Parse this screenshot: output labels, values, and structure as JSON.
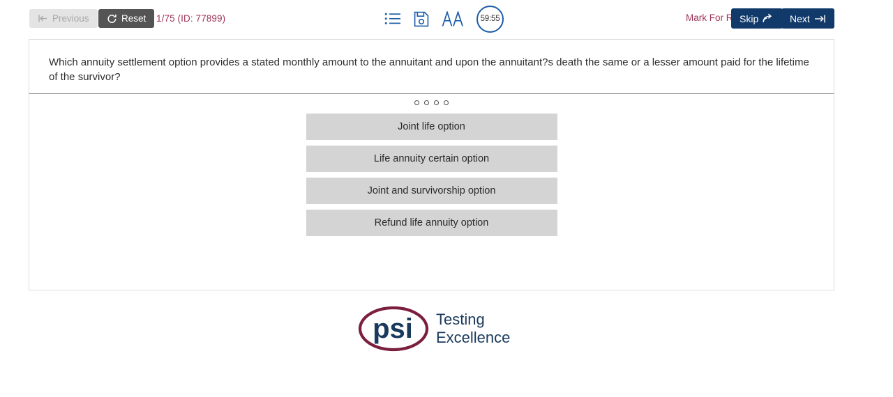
{
  "toolbar": {
    "previous_label": "Previous",
    "previous_icon": "arrow-left-to-bar-icon",
    "reset_label": "Reset",
    "reset_icon": "refresh-icon",
    "page_indicator": "1/75 (ID: 77899)",
    "list_icon": "list-icon",
    "save_icon": "save-floppy-icon",
    "font-size_icon": "font-size-AA-icon",
    "font_size_label": "AA",
    "timer_value": "59:55",
    "timer_icon": "timer-circle-icon",
    "mark_for_review_label": "Mark For Review",
    "mark_for_review_checked": false,
    "skip_label": "Skip",
    "skip_icon": "skip-arrow-icon",
    "next_label": "Next",
    "next_icon": "next-arrow-icon"
  },
  "question": {
    "text": "Which annuity settlement option provides a stated monthly amount to the annuitant and upon the annuitant?s death the same or a lesser amount paid for the lifetime of the survivor?"
  },
  "answers": {
    "markers": [
      "",
      "",
      "",
      ""
    ],
    "options": [
      {
        "label": "Joint life option"
      },
      {
        "label": "Life annuity certain option"
      },
      {
        "label": "Joint and survivorship option"
      },
      {
        "label": "Refund life annuity option"
      }
    ]
  },
  "logo": {
    "wordmark": "psi",
    "tagline_line1": "Testing",
    "tagline_line2": "Excellence"
  },
  "colors": {
    "accent_navy": "#113a6b",
    "accent_maroon": "#9e3458",
    "icon_blue": "#1b5ca8",
    "option_gray": "#d4d4d4",
    "logo_maroon": "#7b1f3d",
    "logo_navy": "#1a3a5c"
  }
}
